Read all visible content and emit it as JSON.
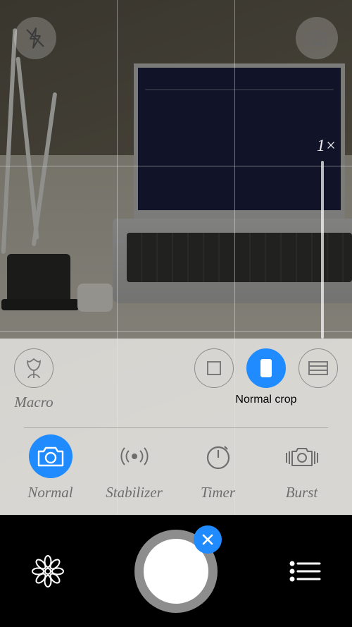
{
  "viewfinder": {
    "zoom_label": "1×"
  },
  "panel": {
    "macro_label": "Macro",
    "crop_label": "Normal crop",
    "crops": {
      "square": "square-crop",
      "portrait": "portrait-crop",
      "landscape": "landscape-crop"
    }
  },
  "modes": {
    "normal": "Normal",
    "stabilizer": "Stabilizer",
    "timer": "Timer",
    "burst": "Burst"
  },
  "icons": {
    "flash": "flash-off-icon",
    "switch": "switch-camera-icon",
    "gallery": "flower-icon",
    "list": "list-icon",
    "close": "close-icon"
  },
  "colors": {
    "accent": "#1f8bff"
  }
}
